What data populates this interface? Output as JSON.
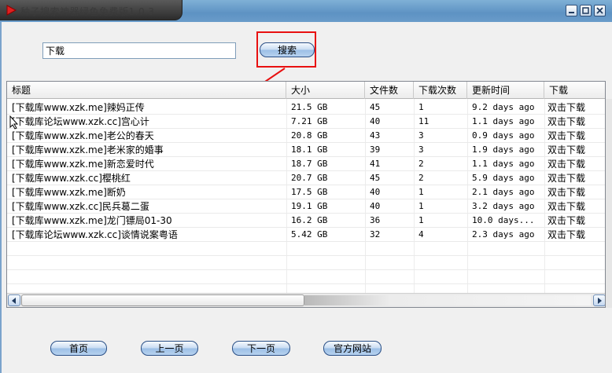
{
  "window": {
    "title": "种子搜索神器绿色免费版1.0.3",
    "colors": {
      "highlight": "#e81010",
      "titlebar": "#6a9cca",
      "button_border": "#2a4f86"
    }
  },
  "search": {
    "value": "下载",
    "button_label": "搜索"
  },
  "table": {
    "columns": [
      "标题",
      "大小",
      "文件数",
      "下载次数",
      "更新时间",
      "下载"
    ],
    "rows": [
      {
        "title": "[下载库www.xzk.me]辣妈正传",
        "size": "21.5 GB",
        "files": "45",
        "downloads": "1",
        "updated": "9.2 days ago",
        "action": "双击下载"
      },
      {
        "title": "[下载库论坛www.xzk.cc]宫心计",
        "size": "7.21 GB",
        "files": "40",
        "downloads": "11",
        "updated": "1.1 days ago",
        "action": "双击下载"
      },
      {
        "title": "[下载库www.xzk.me]老公的春天",
        "size": "20.8 GB",
        "files": "43",
        "downloads": "3",
        "updated": "0.9 days ago",
        "action": "双击下载"
      },
      {
        "title": "[下载库www.xzk.me]老米家的婚事",
        "size": "18.1 GB",
        "files": "39",
        "downloads": "3",
        "updated": "1.9 days ago",
        "action": "双击下载"
      },
      {
        "title": "[下载库www.xzk.me]新恋爱时代",
        "size": "18.7 GB",
        "files": "41",
        "downloads": "2",
        "updated": "1.1 days ago",
        "action": "双击下载"
      },
      {
        "title": "[下载库www.xzk.cc]樱桃红",
        "size": "20.7 GB",
        "files": "45",
        "downloads": "2",
        "updated": "5.9 days ago",
        "action": "双击下载"
      },
      {
        "title": "[下载库www.xzk.me]断奶",
        "size": "17.5 GB",
        "files": "40",
        "downloads": "1",
        "updated": "2.1 days ago",
        "action": "双击下载"
      },
      {
        "title": "[下载库www.xzk.cc]民兵葛二蛋",
        "size": "19.1 GB",
        "files": "40",
        "downloads": "1",
        "updated": "3.2 days ago",
        "action": "双击下载"
      },
      {
        "title": "[下载库www.xzk.me]龙门镖局01-30",
        "size": "16.2 GB",
        "files": "36",
        "downloads": "1",
        "updated": "10.0 days...",
        "action": "双击下载"
      },
      {
        "title": "[下载库论坛www.xzk.cc]谈情说案粤语",
        "size": "5.42 GB",
        "files": "32",
        "downloads": "4",
        "updated": "2.3 days ago",
        "action": "双击下载"
      }
    ]
  },
  "footer": {
    "home": "首页",
    "prev": "上一页",
    "next": "下一页",
    "website": "官方网站"
  }
}
